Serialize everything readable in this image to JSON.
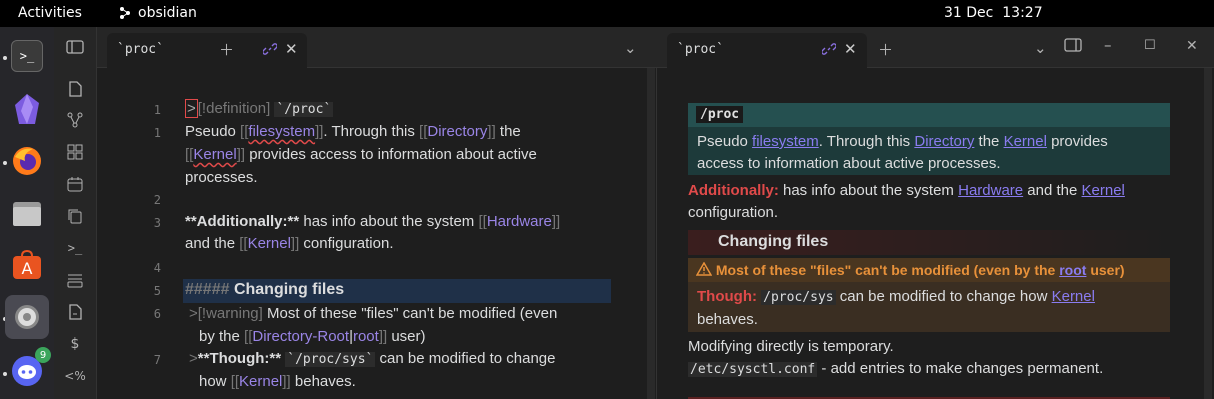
{
  "topbar": {
    "activities": "Activities",
    "app_name": "obsidian",
    "clock_date": "31 Dec",
    "clock_time": "13:27"
  },
  "dock": {
    "items": [
      {
        "name": "terminal",
        "label": ">_"
      },
      {
        "name": "obsidian",
        "label": ""
      },
      {
        "name": "firefox",
        "label": ""
      },
      {
        "name": "files",
        "label": ""
      },
      {
        "name": "app-center",
        "label": ""
      },
      {
        "name": "settings",
        "label": ""
      },
      {
        "name": "discord",
        "label": ""
      }
    ],
    "discord_badge": "9"
  },
  "ribbon": {
    "icons": [
      "file-open-icon",
      "graph-icon",
      "canvas-icon",
      "calendar-icon",
      "copy-icon",
      "terminal-icon",
      "list-add-icon",
      "file-export-icon",
      "dollar-icon",
      "percent-icon"
    ],
    "terminal_glyph": ">_",
    "dollar_glyph": "$",
    "percent_glyph": "<%"
  },
  "left_pane": {
    "tab_title": "`proc`"
  },
  "right_pane": {
    "tab_title": "`proc`"
  },
  "editor": {
    "gutter": [
      "1",
      "1",
      "2",
      "3",
      "4",
      "5",
      "6",
      "7"
    ],
    "l1_mark": ">",
    "l1_callout": "[!definition]",
    "l1_code": "`/proc`",
    "l2_a": "Pseudo ",
    "l2_open": "[[",
    "l2_link": "filesystem",
    "l2_close": "]]",
    "l2_b": ". Through this ",
    "l2_open2": "[[",
    "l2_link2": "Directory",
    "l2_close2": "]]",
    "l2_c": " the",
    "l3_open": "[[",
    "l3_link": "Kernel",
    "l3_close": "]]",
    "l3_text": " provides access to information about active",
    "l4_text": "processes.",
    "l5_bold": "**Additionally:**",
    "l5_text": " has info about the system ",
    "l5_open": "[[",
    "l5_link": "Hardware",
    "l5_close": "]]",
    "l6_a": "and the ",
    "l6_open": "[[",
    "l6_link": "Kernel",
    "l6_close": "]]",
    "l6_b": " configuration.",
    "l7_hash": "#####",
    "l7_head": " Changing files",
    "l8_mark": ">",
    "l8_callout": "[!warning]",
    "l8_text": " Most of these \"files\" can't be modified (even",
    "l9_a": "by the ",
    "l9_open": "[[",
    "l9_link": "Directory-Root",
    "l9_pipe": "|",
    "l9_alias": "root",
    "l9_close": "]]",
    "l9_b": " user)",
    "l10_mark": ">",
    "l10_bold": "**Though:**",
    "l10_code": "`/proc/sys`",
    "l10_text": " can be modified to change",
    "l11_a": "how ",
    "l11_open": "[[",
    "l11_link": "Kernel",
    "l11_close": "]]",
    "l11_b": " behaves."
  },
  "preview": {
    "def_title": "/proc",
    "def_a": "Pseudo ",
    "def_link1": "filesystem",
    "def_b": ". Through this ",
    "def_link2": "Directory",
    "def_c": " the ",
    "def_link3": "Kernel",
    "def_d": " provides",
    "def_line2": "access to information about active processes.",
    "add_bold": "Additionally:",
    "add_text": " has info about the system ",
    "add_link1": "Hardware",
    "add_and": " and the ",
    "add_link2": "Kernel",
    "add_line2": "configuration.",
    "h5": "Changing files",
    "warn_title_a": "Most of these \"files\" can't be modified (even by the ",
    "warn_title_link": "root",
    "warn_title_b": " user)",
    "though_bold": "Though:",
    "though_code": "/proc/sys",
    "though_text": " can be modified to change how ",
    "though_link": "Kernel",
    "though_line2": "behaves.",
    "mod_line": "Modifying directly is temporary.",
    "sysctl_code": "/etc/sysctl.conf",
    "sysctl_text": " - add entries to make changes permanent."
  },
  "colors": {
    "accent": "#8a7cf0",
    "warning": "#e8913a",
    "danger": "#e04a4a"
  }
}
